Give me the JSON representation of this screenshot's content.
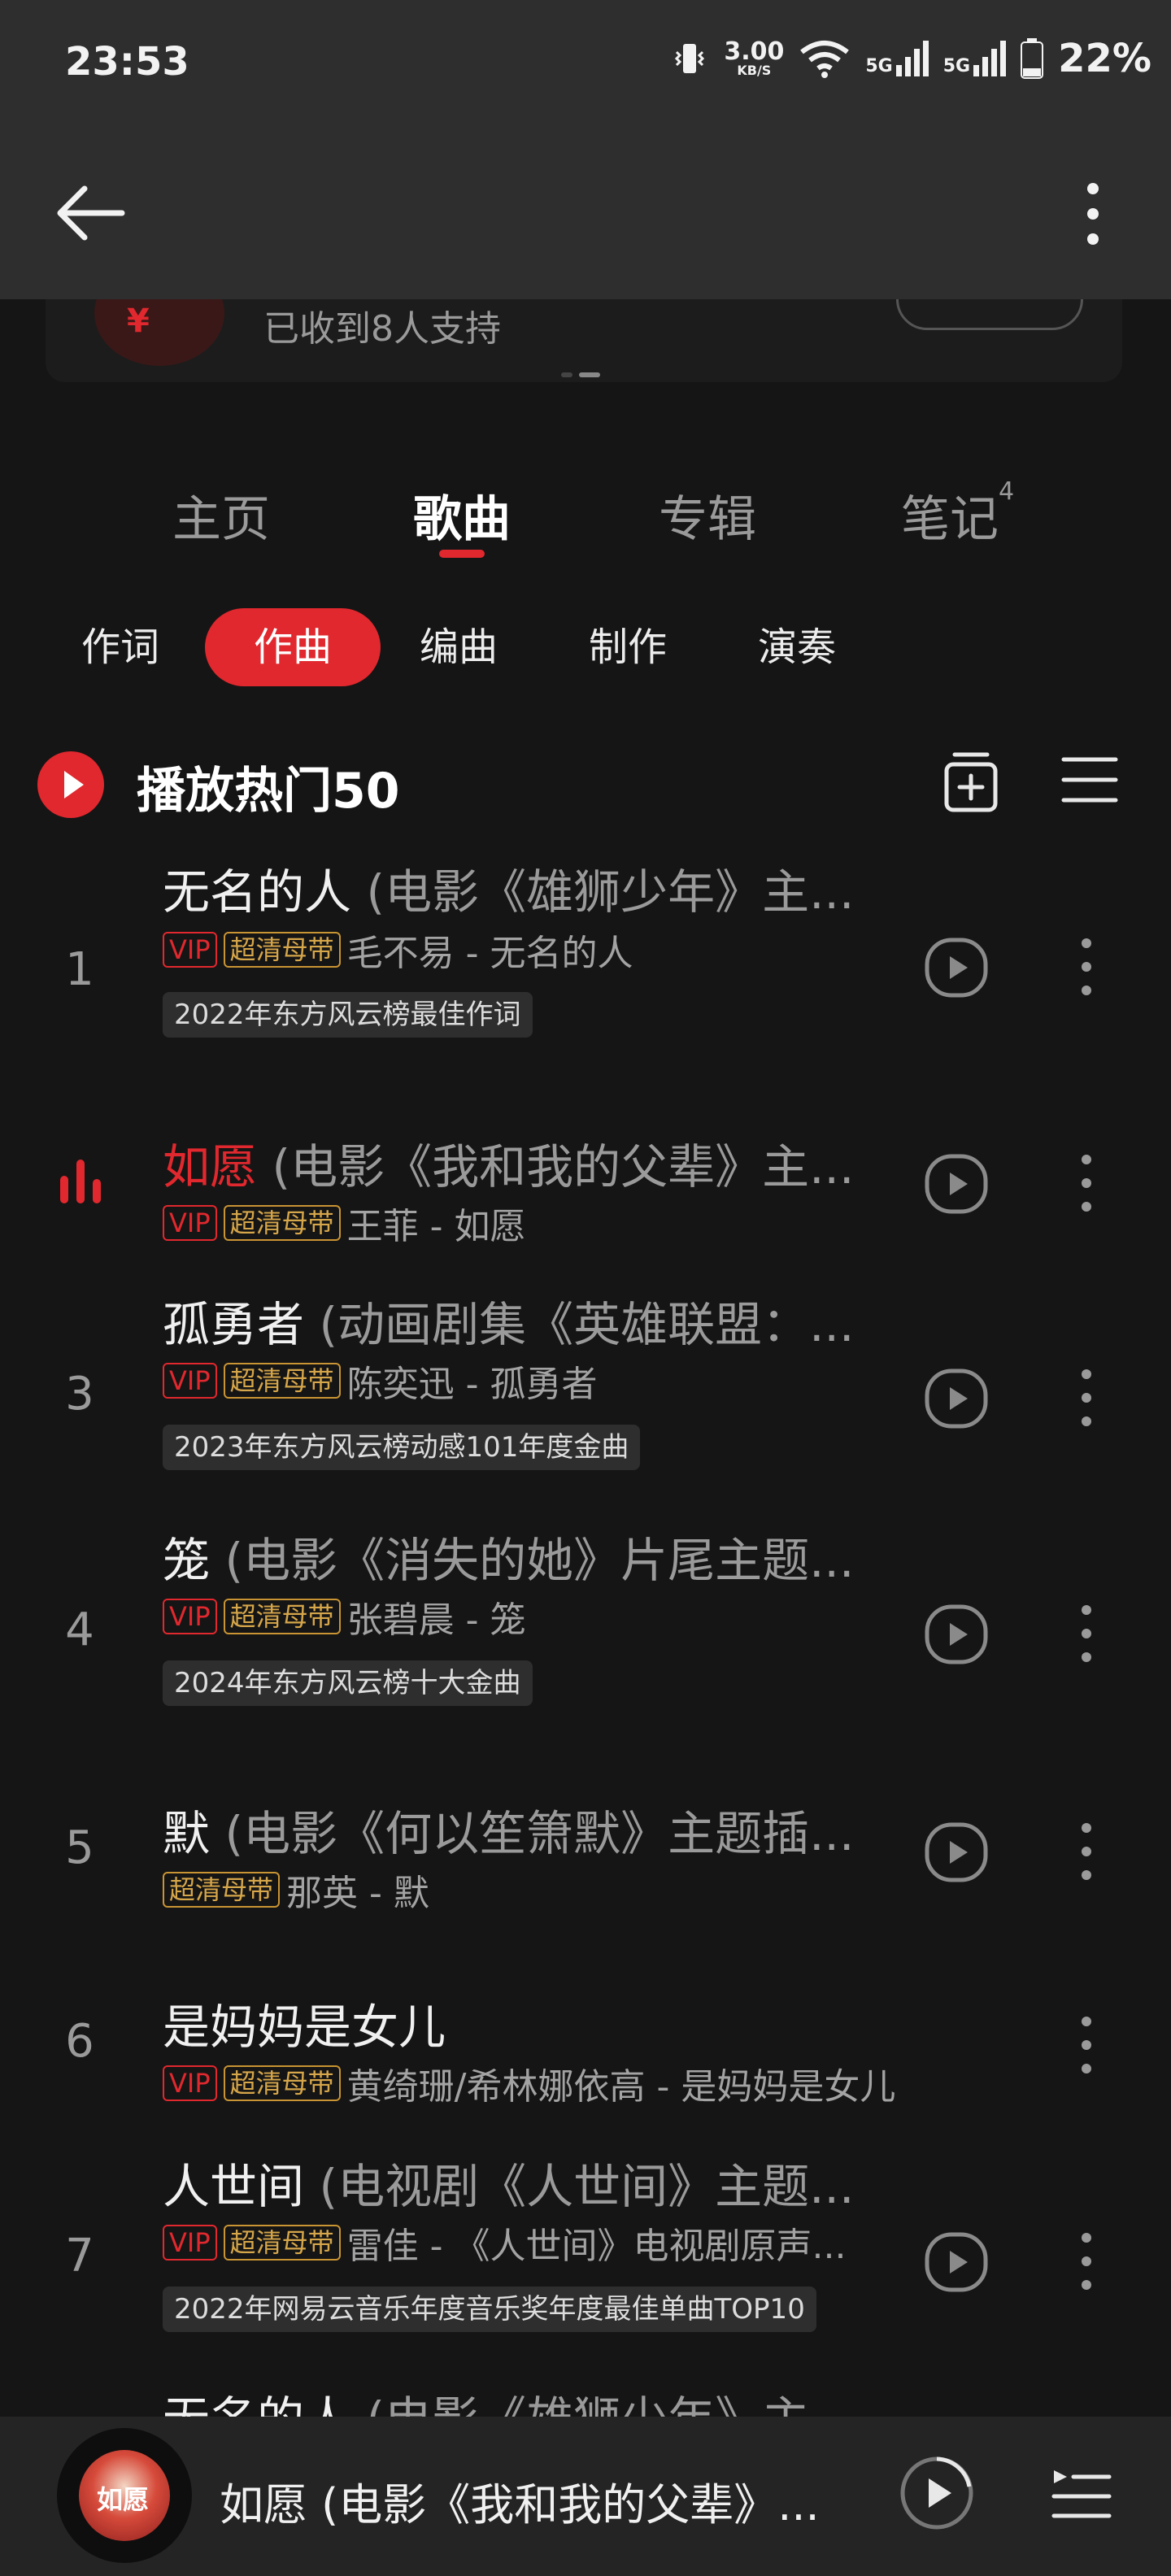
{
  "status": {
    "time": "23:53",
    "speed_value": "3.00",
    "speed_unit": "KB/S",
    "net1": "5G",
    "net2": "5G",
    "battery": "22%"
  },
  "support": {
    "text": "已收到8人支持"
  },
  "tabs": [
    {
      "label": "主页"
    },
    {
      "label": "歌曲"
    },
    {
      "label": "专辑"
    },
    {
      "label": "笔记",
      "count": "4"
    }
  ],
  "filters": [
    {
      "label": "作词"
    },
    {
      "label": "作曲"
    },
    {
      "label": "编曲"
    },
    {
      "label": "制作"
    },
    {
      "label": "演奏"
    }
  ],
  "playlist": {
    "title": "播放热门50"
  },
  "songs": [
    {
      "num": "1",
      "title": "无名的人",
      "subtitle": "(电影《雄狮少年》主...",
      "vip": "VIP",
      "hq": "超清母带",
      "artist_line": "毛不易 - 无名的人",
      "award": "2022年东方风云榜最佳作词"
    },
    {
      "num": "",
      "title": "如愿",
      "subtitle": "(电影《我和我的父辈》主...",
      "vip": "VIP",
      "hq": "超清母带",
      "artist_line": "王菲 - 如愿"
    },
    {
      "num": "3",
      "title": "孤勇者",
      "subtitle": "(动画剧集《英雄联盟：...",
      "vip": "VIP",
      "hq": "超清母带",
      "artist_line": "陈奕迅 - 孤勇者",
      "award": "2023年东方风云榜动感101年度金曲"
    },
    {
      "num": "4",
      "title": "笼",
      "subtitle": "(电影《消失的她》片尾主题...",
      "vip": "VIP",
      "hq": "超清母带",
      "artist_line": "张碧晨 - 笼",
      "award": "2024年东方风云榜十大金曲"
    },
    {
      "num": "5",
      "title": "默",
      "subtitle": "(电影《何以笙箫默》主题插...",
      "hq": "超清母带",
      "artist_line": "那英 - 默"
    },
    {
      "num": "6",
      "title": "是妈妈是女儿",
      "subtitle": "",
      "vip": "VIP",
      "hq": "超清母带",
      "artist_line": "黄绮珊/希林娜依高 - 是妈妈是女儿"
    },
    {
      "num": "7",
      "title": "人世间",
      "subtitle": "(电视剧《人世间》主题...",
      "vip": "VIP",
      "hq": "超清母带",
      "artist_line": "雷佳 - 《人世间》电视剧原声...",
      "award": "2022年网易云音乐年度音乐奖年度最佳单曲TOP10"
    }
  ],
  "player": {
    "cover_text": "如愿",
    "now_playing": "如愿 (电影《我和我的父辈》..."
  },
  "colors": {
    "accent": "#e0282e",
    "hq_gold": "#c99433",
    "background": "#151515"
  }
}
